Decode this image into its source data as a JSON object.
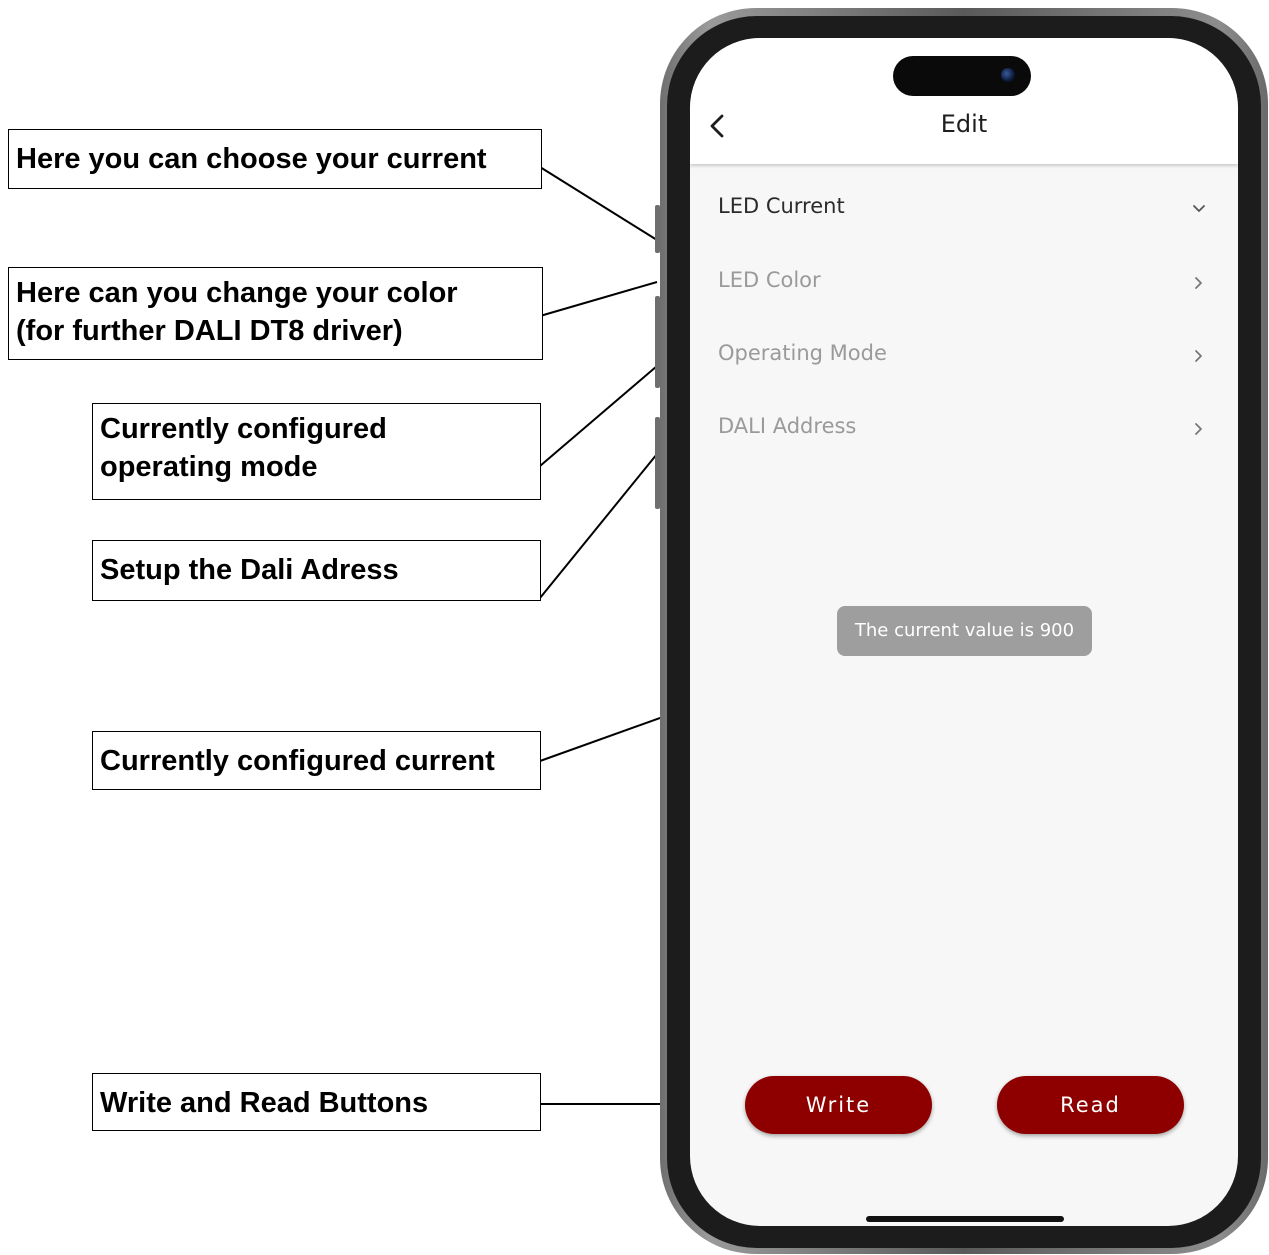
{
  "callouts": {
    "current": "Here you can choose your current",
    "color_line1": "Here can you change your color",
    "color_line2": "(for further DALI DT8 driver)",
    "mode_line1": "Currently configured",
    "mode_line2": "operating mode",
    "dali": "Setup the Dali Adress",
    "configured_current": "Currently configured current",
    "buttons": "Write and Read Buttons"
  },
  "screen": {
    "title": "Edit",
    "back_icon": "chevron-left-icon",
    "menu": [
      {
        "label": "LED Current",
        "icon": "chevron-down-icon",
        "color": "#2b2b2b"
      },
      {
        "label": "LED Color",
        "icon": "chevron-right-icon",
        "color": "#9a9a9a"
      },
      {
        "label": "Operating Mode",
        "icon": "chevron-right-icon",
        "color": "#9a9a9a"
      },
      {
        "label": "DALI Address",
        "icon": "chevron-right-icon",
        "color": "#9a9a9a"
      }
    ],
    "toast": "The current value is 900",
    "write_label": "Write",
    "read_label": "Read"
  },
  "colors": {
    "accent": "#8e0000",
    "toast_bg": "#9e9e9e",
    "active_text": "#2b2b2b",
    "inactive_text": "#9a9a9a"
  }
}
